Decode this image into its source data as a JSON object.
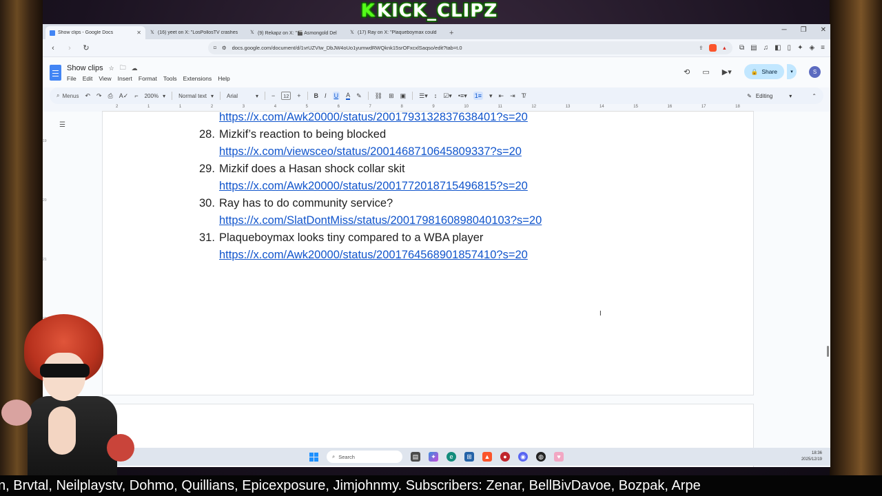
{
  "overlay": {
    "logo_prefix": "K",
    "logo_text": "KICK_CLIPZ",
    "ticker": "n, Brvtal, Neilplaystv, Dohmo, Quillians, Epicexposure, Jimjohnmy. Subscribers: Zenar, BellBivDavoe, Bozpak, Arpe"
  },
  "browser": {
    "tabs": [
      {
        "title": "Show clips - Google Docs",
        "icon": "docs-icon",
        "active": true
      },
      {
        "title": "(16) yeet on X: \"LosPollosTV crashes",
        "icon": "x-icon",
        "active": false
      },
      {
        "title": "(9) Rekapz on X: \"🎬 Asmongold Del",
        "icon": "x-icon",
        "active": false
      },
      {
        "title": "(17) Ray on X: \"Plaqueboymax could",
        "icon": "x-icon",
        "active": false
      }
    ],
    "url": "docs.google.com/document/d/1vrUZVIw_DbJW4oUo1yumwdRWQknk15srOFxcxlSaqso/edit?tab=t.0",
    "brave_badge": "2"
  },
  "docs": {
    "title": "Show clips",
    "menu": [
      "File",
      "Edit",
      "View",
      "Insert",
      "Format",
      "Tools",
      "Extensions",
      "Help"
    ],
    "share_label": "Share",
    "avatar_letter": "S",
    "toolbar": {
      "menus_label": "Menus",
      "zoom": "200%",
      "style": "Normal text",
      "font": "Arial",
      "font_size": "12",
      "mode": "Editing"
    },
    "ruler_marks": [
      "2",
      "1",
      "1",
      "2",
      "3",
      "4",
      "5",
      "6",
      "7",
      "8",
      "9",
      "10",
      "11",
      "12",
      "13",
      "14",
      "15",
      "16",
      "17",
      "18"
    ],
    "first_link": "https://x.com/Awk20000/status/2001793132837638401?s=20",
    "entries": [
      {
        "num": "28.",
        "title": "Mizkif’s reaction to being blocked",
        "link": "https://x.com/viewsceo/status/2001468710645809337?s=20"
      },
      {
        "num": "29.",
        "title": "Mizkif does a Hasan shock collar skit",
        "link": "https://x.com/Awk20000/status/2001772018715496815?s=20"
      },
      {
        "num": "30.",
        "title": "Ray has to do community service?",
        "link": "https://x.com/SlatDontMiss/status/2001798160898040103?s=20"
      },
      {
        "num": "31.",
        "title": "Plaqueboymax looks tiny compared to a WBA player",
        "link": "https://x.com/Awk20000/status/2001764568901857410?s=20"
      }
    ]
  },
  "taskbar": {
    "search_label": "Search",
    "time": "18:36",
    "date": "2025/12/19"
  },
  "colors": {
    "link": "#1155cc",
    "share_bg": "#c2e7ff",
    "kick_green": "#53fc18"
  }
}
